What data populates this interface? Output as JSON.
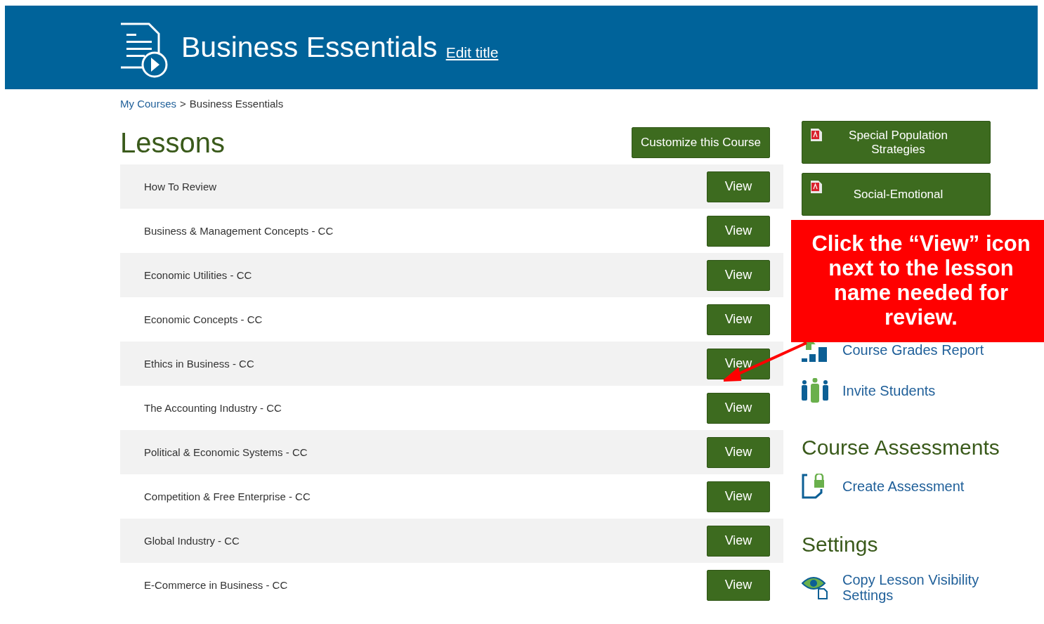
{
  "header": {
    "title": "Business Essentials",
    "edit_link": "Edit title"
  },
  "breadcrumb": {
    "link": "My Courses",
    "separator": ">",
    "current": "Business Essentials"
  },
  "lessons": {
    "heading": "Lessons",
    "customize_button": "Customize this Course",
    "rows": [
      {
        "name": "How To Review",
        "button": "View"
      },
      {
        "name": "Business & Management Concepts - CC",
        "button": "View"
      },
      {
        "name": "Economic Utilities - CC",
        "button": "View"
      },
      {
        "name": "Economic Concepts - CC",
        "button": "View"
      },
      {
        "name": "Ethics in Business - CC",
        "button": "View"
      },
      {
        "name": "The Accounting Industry - CC",
        "button": "View"
      },
      {
        "name": "Political & Economic Systems - CC",
        "button": "View"
      },
      {
        "name": "Competition & Free Enterprise - CC",
        "button": "View"
      },
      {
        "name": "Global Industry - CC",
        "button": "View"
      },
      {
        "name": "E-Commerce in Business - CC",
        "button": "View"
      }
    ]
  },
  "resources": [
    {
      "label": "Special Population Strategies"
    },
    {
      "label": "Social-Emotional"
    }
  ],
  "tools": [
    {
      "kind": "grades",
      "label": "Course Grades Report"
    },
    {
      "kind": "invite",
      "label": "Invite Students"
    }
  ],
  "assessments": {
    "heading": "Course Assessments",
    "items": [
      {
        "kind": "assessment",
        "label": "Create Assessment"
      }
    ]
  },
  "settings": {
    "heading": "Settings",
    "items": [
      {
        "kind": "visibility",
        "label": "Copy Lesson Visibility Settings"
      }
    ]
  },
  "callout": {
    "text": "Click the “View” icon next to the lesson name needed for review."
  }
}
